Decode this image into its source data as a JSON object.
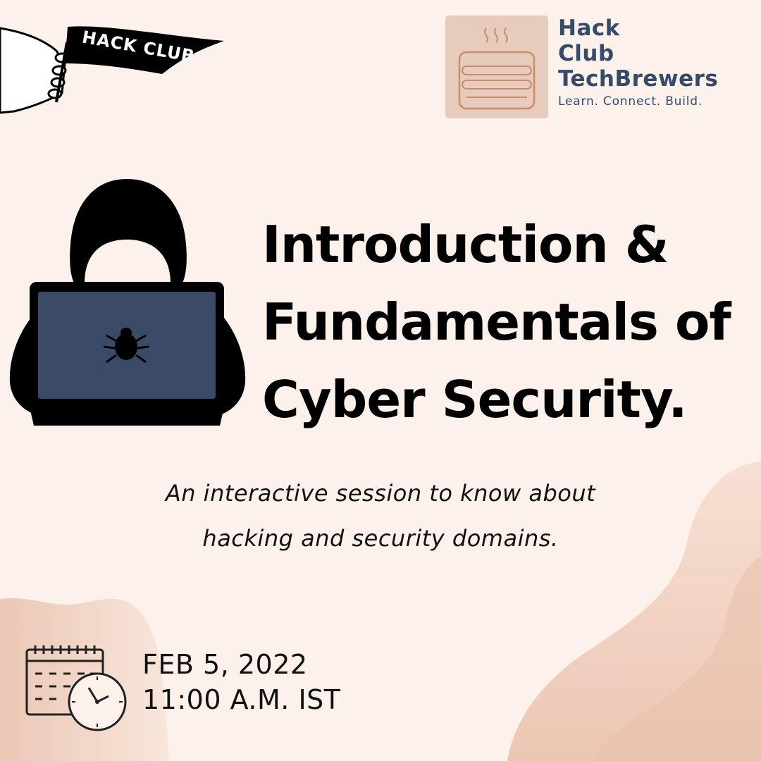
{
  "brand": {
    "badge_text": "HACK CLUB",
    "name_lines": [
      "Hack",
      "Club",
      "TechBrewers"
    ],
    "tagline": "Learn. Connect. Build."
  },
  "event": {
    "title_lines": [
      "Introduction &",
      "Fundamentals of",
      "Cyber Security."
    ],
    "description_lines": [
      "An interactive session to know about",
      "hacking and security domains."
    ],
    "date": "FEB 5, 2022",
    "time": "11:00 A.M. IST"
  },
  "icons": {
    "flag": "hack-club-flag-icon",
    "logo": "coffee-cup-logo-icon",
    "hacker": "hooded-hacker-laptop-icon",
    "bug": "bug-icon",
    "calendar": "calendar-clock-icon"
  },
  "colors": {
    "background": "#fcf1eb",
    "blob": "#f0d3c4",
    "brand_text": "#364a69",
    "laptop_screen": "#3b4b67",
    "logo_bg": "#e7cbbd",
    "logo_stroke": "#c98b6b"
  }
}
